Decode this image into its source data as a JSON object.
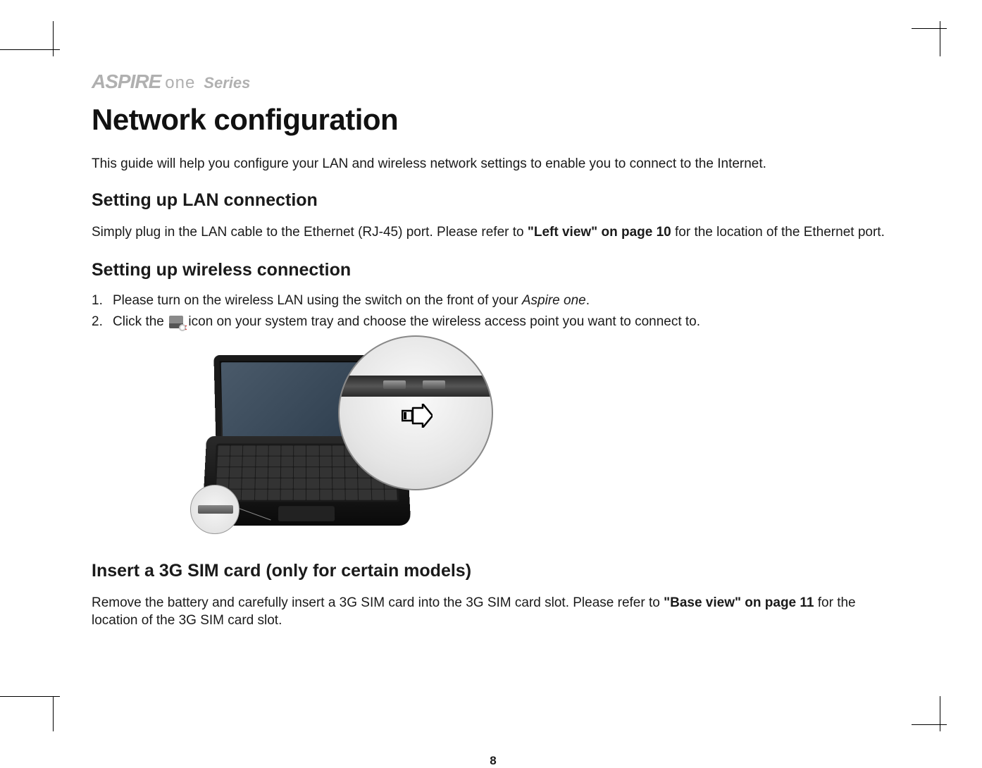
{
  "brand": {
    "logo_text": "ASPIRE",
    "sub_logo": "one",
    "series_label": "Series"
  },
  "page_title": "Network configuration",
  "intro_text": "This guide will help you configure your LAN and wireless network settings to enable you to connect to the Internet.",
  "sections": {
    "lan": {
      "heading": "Setting up LAN connection",
      "text_before_ref": "Simply plug in the LAN cable to the Ethernet (RJ-45) port. Please refer to ",
      "ref": "\"Left view\" on page 10",
      "text_after_ref": " for the location of the Ethernet port."
    },
    "wireless": {
      "heading": "Setting up wireless connection",
      "steps": [
        {
          "num": "1.",
          "text_before_italic": "Please turn on the wireless LAN using the switch on the front of your ",
          "italic": "Aspire one",
          "text_after_italic": "."
        },
        {
          "num": "2.",
          "text_before_icon": "Click the ",
          "text_after_icon": " icon on your system tray and choose the wireless access point you want to connect to."
        }
      ]
    },
    "sim": {
      "heading": "Insert a 3G SIM card (only for certain models)",
      "text_before_ref": "Remove the battery and carefully insert a 3G SIM card into the 3G SIM card slot. Please refer to ",
      "ref": "\"Base view\" on page 11",
      "text_after_ref": " for the location of the 3G SIM card slot."
    }
  },
  "page_number": "8",
  "icons": {
    "wireless_tray": "wireless-network-tray-icon",
    "switch_arrow": "slide-right-arrow-icon"
  }
}
